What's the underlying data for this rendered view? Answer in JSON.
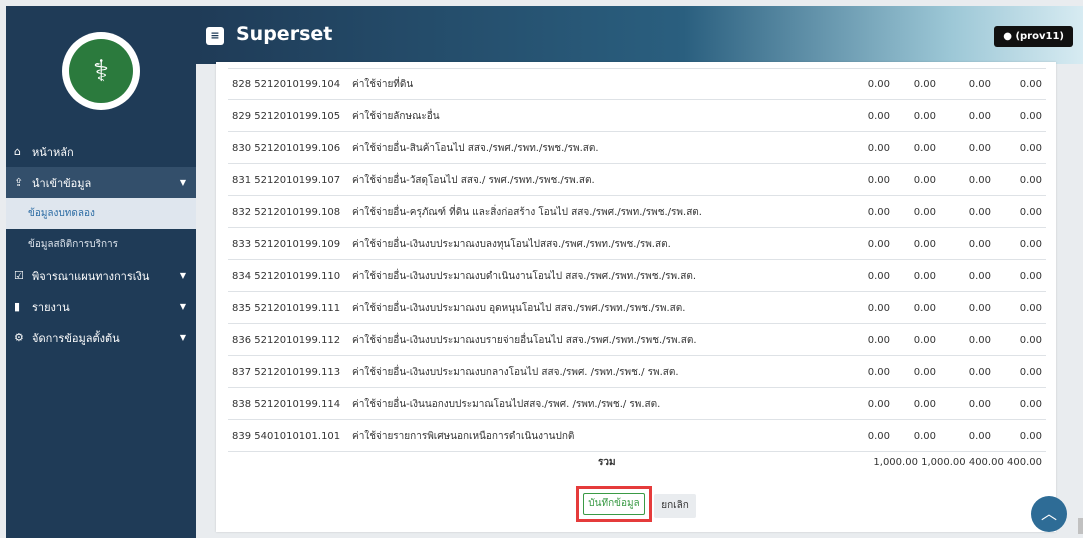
{
  "app": {
    "title": "Superset",
    "user": "(prov11)"
  },
  "sidebar": {
    "items": [
      {
        "icon": "home-icon",
        "label": "หน้าหลัก"
      },
      {
        "icon": "upload-icon",
        "label": "นำเข้าข้อมูล"
      },
      {
        "label": "ข้อมูลงบทดลอง"
      },
      {
        "label": "ข้อมูลสถิติการบริการ"
      },
      {
        "icon": "check-square-icon",
        "label": "พิจารณาแผนทางการเงิน"
      },
      {
        "icon": "file-icon",
        "label": "รายงาน"
      },
      {
        "icon": "gear-icon",
        "label": "จัดการข้อมูลตั้งต้น"
      }
    ]
  },
  "table": {
    "rows": [
      {
        "code": "828  5212010199.104",
        "name": "ค่าใช้จ่ายที่ดิน",
        "v1": "0.00",
        "v2": "0.00",
        "v3": "0.00",
        "v4": "0.00"
      },
      {
        "code": "829  5212010199.105",
        "name": "ค่าใช้จ่ายลักษณะอื่น",
        "v1": "0.00",
        "v2": "0.00",
        "v3": "0.00",
        "v4": "0.00"
      },
      {
        "code": "830  5212010199.106",
        "name": "ค่าใช้จ่ายอื่น-สินค้าโอนไป สสจ./รพศ./รพท./รพช./รพ.สต.",
        "v1": "0.00",
        "v2": "0.00",
        "v3": "0.00",
        "v4": "0.00"
      },
      {
        "code": "831  5212010199.107",
        "name": "ค่าใช้จ่ายอื่น-วัสดุโอนไป สสจ./ รพศ./รพท./รพช./รพ.สต.",
        "v1": "0.00",
        "v2": "0.00",
        "v3": "0.00",
        "v4": "0.00"
      },
      {
        "code": "832  5212010199.108",
        "name": "ค่าใช้จ่ายอื่น-ครุภัณฑ์ ที่ดิน และสิ่งก่อสร้าง โอนไป สสจ./รพศ./รพท./รพช./รพ.สต.",
        "v1": "0.00",
        "v2": "0.00",
        "v3": "0.00",
        "v4": "0.00"
      },
      {
        "code": "833  5212010199.109",
        "name": "ค่าใช้จ่ายอื่น-เงินงบประมาณงบลงทุนโอนไปสสจ./รพศ./รพท./รพช./รพ.สต.",
        "v1": "0.00",
        "v2": "0.00",
        "v3": "0.00",
        "v4": "0.00"
      },
      {
        "code": "834  5212010199.110",
        "name": "ค่าใช้จ่ายอื่น-เงินงบประมาณงบดำเนินงานโอนไป สสจ./รพศ./รพท./รพช./รพ.สต.",
        "v1": "0.00",
        "v2": "0.00",
        "v3": "0.00",
        "v4": "0.00"
      },
      {
        "code": "835  5212010199.111",
        "name": "ค่าใช้จ่ายอื่น-เงินงบประมาณงบ อุดหนุนโอนไป สสจ./รพศ./รพท./รพช./รพ.สต.",
        "v1": "0.00",
        "v2": "0.00",
        "v3": "0.00",
        "v4": "0.00"
      },
      {
        "code": "836  5212010199.112",
        "name": "ค่าใช้จ่ายอื่น-เงินงบประมาณงบรายจ่ายอื่นโอนไป สสจ./รพศ./รพท./รพช./รพ.สต.",
        "v1": "0.00",
        "v2": "0.00",
        "v3": "0.00",
        "v4": "0.00"
      },
      {
        "code": "837  5212010199.113",
        "name": "ค่าใช้จ่ายอื่น-เงินงบประมาณงบกลางโอนไป สสจ./รพศ. /รพท./รพช./ รพ.สต.",
        "v1": "0.00",
        "v2": "0.00",
        "v3": "0.00",
        "v4": "0.00"
      },
      {
        "code": "838  5212010199.114",
        "name": "ค่าใช้จ่ายอื่น-เงินนอกงบประมาณโอนไปสสจ./รพศ. /รพท./รพช./ รพ.สต.",
        "v1": "0.00",
        "v2": "0.00",
        "v3": "0.00",
        "v4": "0.00"
      },
      {
        "code": "839  5401010101.101",
        "name": "ค่าใช้จ่ายรายการพิเศษนอกเหนือการดำเนินงานปกติ",
        "v1": "0.00",
        "v2": "0.00",
        "v3": "0.00",
        "v4": "0.00"
      }
    ],
    "total_label": "รวม",
    "total_values": "1,000.00  1,000.00  400.00  400.00"
  },
  "actions": {
    "save_label": "บันทึกข้อมูล",
    "cancel_label": "ยกเลิก"
  }
}
